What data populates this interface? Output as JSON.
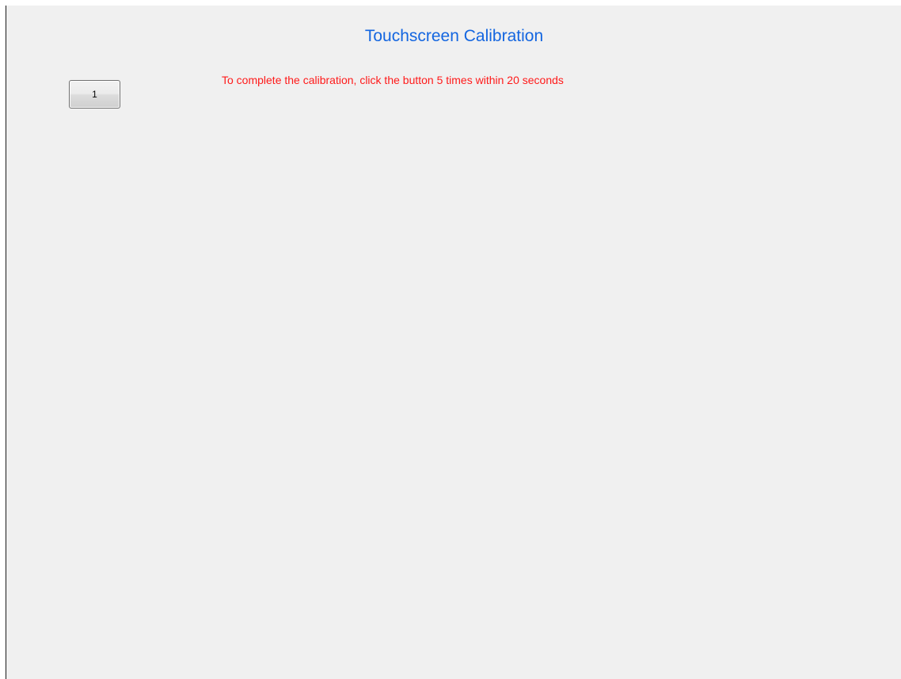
{
  "calibration": {
    "title": "Touchscreen Calibration",
    "instruction": "To complete the calibration, click the button 5 times within 20 seconds",
    "button_label": "1"
  },
  "colors": {
    "background": "#f0f0f0",
    "title": "#1466e0",
    "instruction": "#ff1a1a"
  }
}
